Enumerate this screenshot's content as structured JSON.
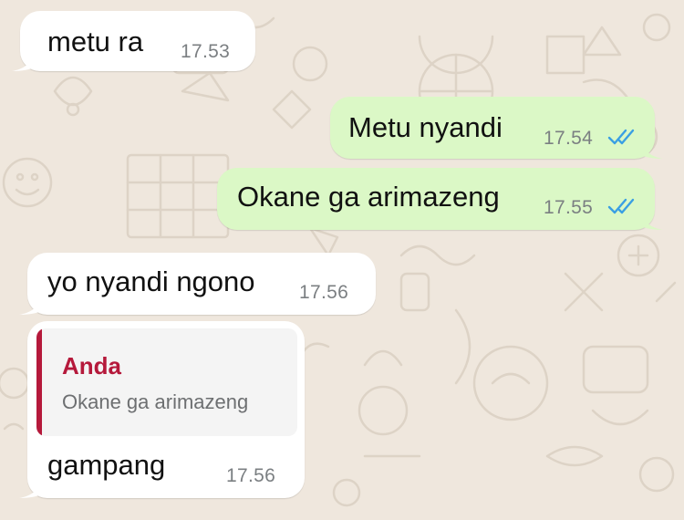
{
  "theme": {
    "incoming_bg": "#ffffff",
    "outgoing_bg": "#dbf8c6",
    "read_tick_color": "#3a9fe3",
    "quote_author_color": "#b5193b",
    "quote_bar_color": "#b5193b"
  },
  "messages": [
    {
      "direction": "incoming",
      "text": "metu ra",
      "time": "17.53"
    },
    {
      "direction": "outgoing",
      "text": "Metu nyandi",
      "time": "17.54",
      "status": "read-double-check-icon"
    },
    {
      "direction": "outgoing",
      "text": "Okane ga arimazeng",
      "time": "17.55",
      "status": "read-double-check-icon"
    },
    {
      "direction": "incoming",
      "text": "yo nyandi ngono",
      "time": "17.56"
    },
    {
      "direction": "incoming",
      "reply": {
        "author": "Anda",
        "text": "Okane ga arimazeng"
      },
      "text": "gampang",
      "time": "17.56"
    }
  ]
}
